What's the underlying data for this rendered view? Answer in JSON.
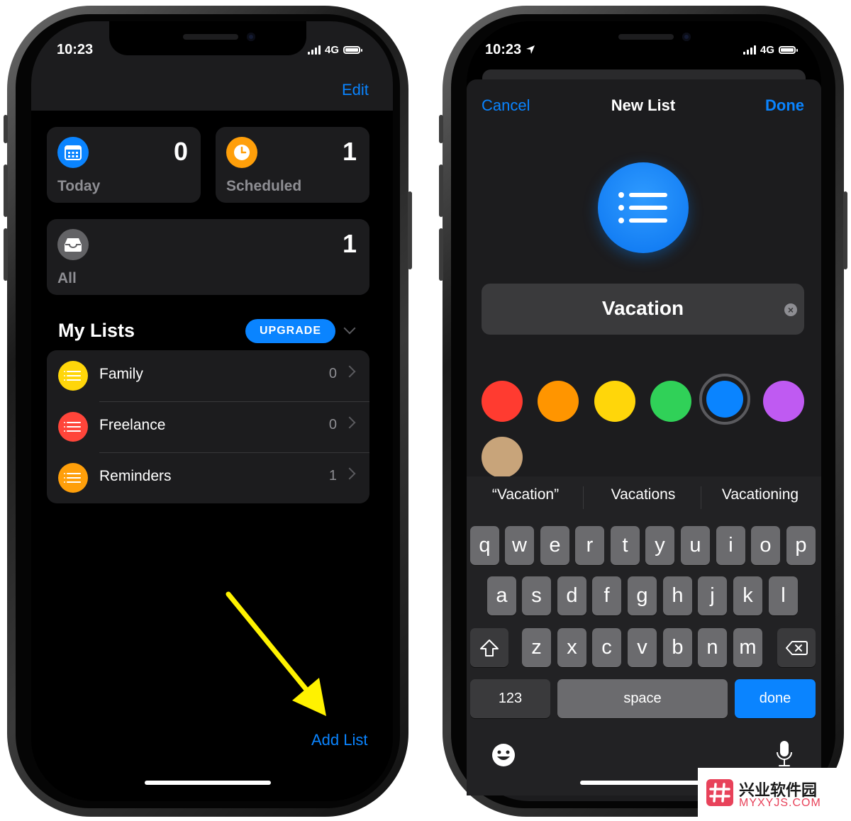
{
  "left_phone": {
    "status_time": "10:23",
    "network": "4G",
    "edit_label": "Edit",
    "smart_lists": [
      {
        "label": "Today",
        "count": "0",
        "color": "#0a84ff"
      },
      {
        "label": "Scheduled",
        "count": "1",
        "color": "#ff9f0a"
      },
      {
        "label": "All",
        "count": "1",
        "color": "#636366"
      }
    ],
    "my_lists_title": "My Lists",
    "upgrade_label": "UPGRADE",
    "lists": [
      {
        "name": "Family",
        "count": "0",
        "color": "#ffd60a"
      },
      {
        "name": "Freelance",
        "count": "0",
        "color": "#ff453a"
      },
      {
        "name": "Reminders",
        "count": "1",
        "color": "#ff9f0a"
      }
    ],
    "add_list_label": "Add List",
    "annotation_arrow_color": "#fff200"
  },
  "right_phone": {
    "status_time": "10:23",
    "network": "4G",
    "cancel_label": "Cancel",
    "title": "New List",
    "done_label": "Done",
    "list_icon": "list-bullet-icon",
    "name_value": "Vacation",
    "colors": [
      "#ff3b30",
      "#ff9500",
      "#ffd60a",
      "#30d158",
      "#0a84ff",
      "#bf5af2",
      "#c8a47a"
    ],
    "selected_color": "#0a84ff",
    "suggestions": [
      "“Vacation”",
      "Vacations",
      "Vacationing"
    ],
    "keyboard": {
      "row1": [
        "q",
        "w",
        "e",
        "r",
        "t",
        "y",
        "u",
        "i",
        "o",
        "p"
      ],
      "row2": [
        "a",
        "s",
        "d",
        "f",
        "g",
        "h",
        "j",
        "k",
        "l"
      ],
      "row3": [
        "z",
        "x",
        "c",
        "v",
        "b",
        "n",
        "m"
      ],
      "numbers_key": "123",
      "space_key": "space",
      "done_key": "done"
    }
  },
  "watermark": {
    "title": "兴业软件园",
    "url": "MYXYJS.COM"
  }
}
